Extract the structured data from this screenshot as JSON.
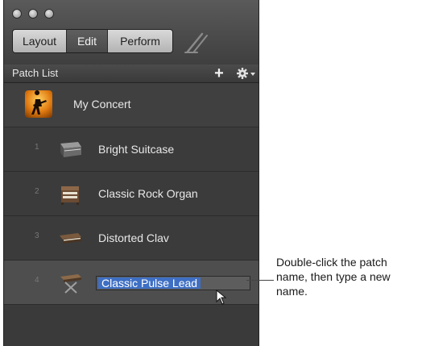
{
  "toolbar": {
    "tabs": [
      {
        "label": "Layout",
        "active": false
      },
      {
        "label": "Edit",
        "active": true
      },
      {
        "label": "Perform",
        "active": false
      }
    ]
  },
  "patch_list": {
    "title": "Patch List",
    "add_label": "+",
    "concert": {
      "name": "My Concert",
      "icon": "concert-guitarist-icon"
    },
    "patches": [
      {
        "number": "1",
        "name": "Bright Suitcase",
        "icon": "electric-piano-icon"
      },
      {
        "number": "2",
        "name": "Classic Rock Organ",
        "icon": "organ-icon"
      },
      {
        "number": "3",
        "name": "Distorted Clav",
        "icon": "clavinet-icon"
      },
      {
        "number": "4",
        "name": "Classic Pulse Lead",
        "icon": "synth-keyboard-stand-icon",
        "editing": true
      }
    ]
  },
  "callout": {
    "lines": [
      "Double-click the patch",
      "name, then type a new",
      "name."
    ]
  },
  "colors": {
    "selection": "#3e6fc4",
    "panel": "#3a3a3a"
  }
}
